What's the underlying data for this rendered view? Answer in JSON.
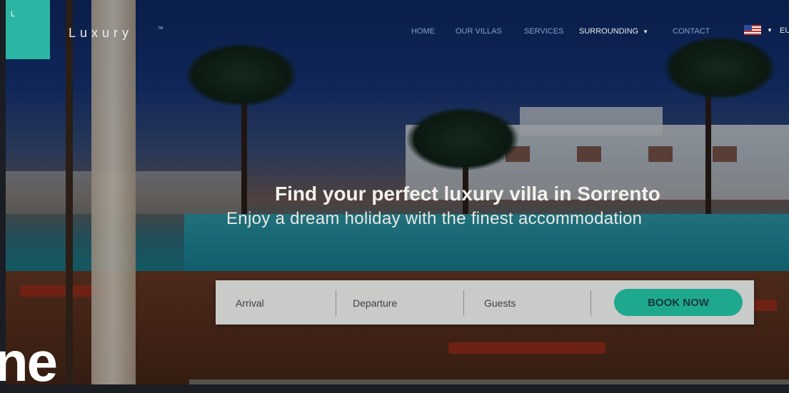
{
  "brand": {
    "logo_letter": "L",
    "name": "Luxury",
    "tm": "TM"
  },
  "nav": {
    "items": [
      {
        "label": "HOME"
      },
      {
        "label": "OUR VILLAS"
      },
      {
        "label": "SERVICES"
      },
      {
        "label": "SURROUNDING"
      },
      {
        "label": "CONTACT"
      }
    ],
    "language": "EU"
  },
  "hero": {
    "headline": "Find your perfect luxury villa in Sorrento",
    "subline": "Enjoy a dream holiday with the finest accommodation"
  },
  "booking": {
    "arrival": "Arrival",
    "departure": "Departure",
    "guests": "Guests",
    "book_label": "BOOK NOW"
  },
  "overlay": {
    "text": "ne"
  },
  "colors": {
    "accent": "#2bb6a3",
    "button": "#1ea98f"
  },
  "icons": {
    "nav_dropdown": "caret-down-icon",
    "language_flag": "us-flag-icon"
  }
}
